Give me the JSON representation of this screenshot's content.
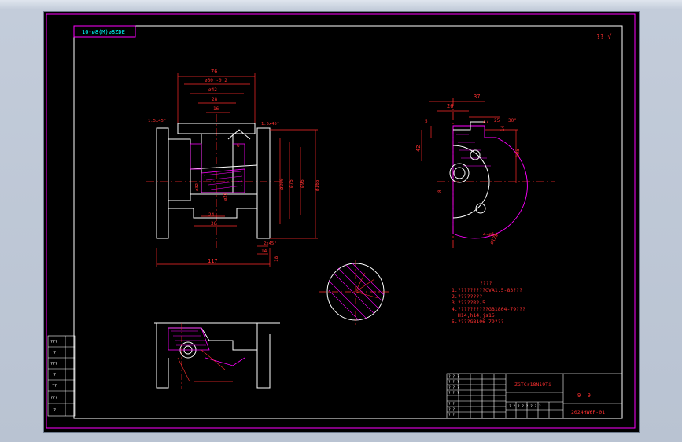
{
  "colors": {
    "background": "#000000",
    "frame": "#b9c3d2",
    "outline": "#ffffff",
    "border": "#ff00ff",
    "dimension": "#ff2a2a",
    "hatch": "#ff00ff",
    "centerline": "#ff2a2a",
    "annotation": "#ff3030",
    "table_line": "#ffffff"
  },
  "header_tag": "10-ø8(M)ø8ZDE",
  "roughness_mark": "?? √",
  "front_view": {
    "dims": {
      "d76": "76",
      "d60": "ø60 -0.2",
      "d42": "ø42",
      "d28": "28",
      "d16": "16",
      "chamfer_left": "1.5x45°",
      "chamfer_right": "1.5x45°",
      "d6": "6",
      "d200": "ø200",
      "d75": "ø75",
      "d95": "ø95",
      "d165": "ø165",
      "d24": "24",
      "d36": "36",
      "d117": "117",
      "d14": "14",
      "d18": "18",
      "chamfer_bottom": "2x45°",
      "d32": "ø32",
      "d26": "ø26"
    }
  },
  "side_view": {
    "dims": {
      "d37": "37",
      "d26": "26",
      "d5": "5",
      "d42": "42",
      "d8": "8",
      "d14": "14",
      "d30": "30°",
      "d25": "25",
      "d47": "47",
      "d105": "105",
      "holes": "4-ø14",
      "pcd": "ø125"
    }
  },
  "notes": {
    "title": "????",
    "items": [
      "1.?????????CVA1.5-83???",
      "2.????????",
      "3.?????R2-5",
      "4.??????????GB1804-79???",
      "  H14,h14,js15",
      "5.????GB106-79???"
    ]
  },
  "title_block": {
    "material": "ZGTCr18Ni9Ti",
    "scale": "9  9",
    "drawing_no": "2024HW6P-01"
  },
  "left_table": {
    "rows": [
      "???",
      "?",
      "???",
      "?",
      "??",
      "???",
      "?"
    ]
  }
}
